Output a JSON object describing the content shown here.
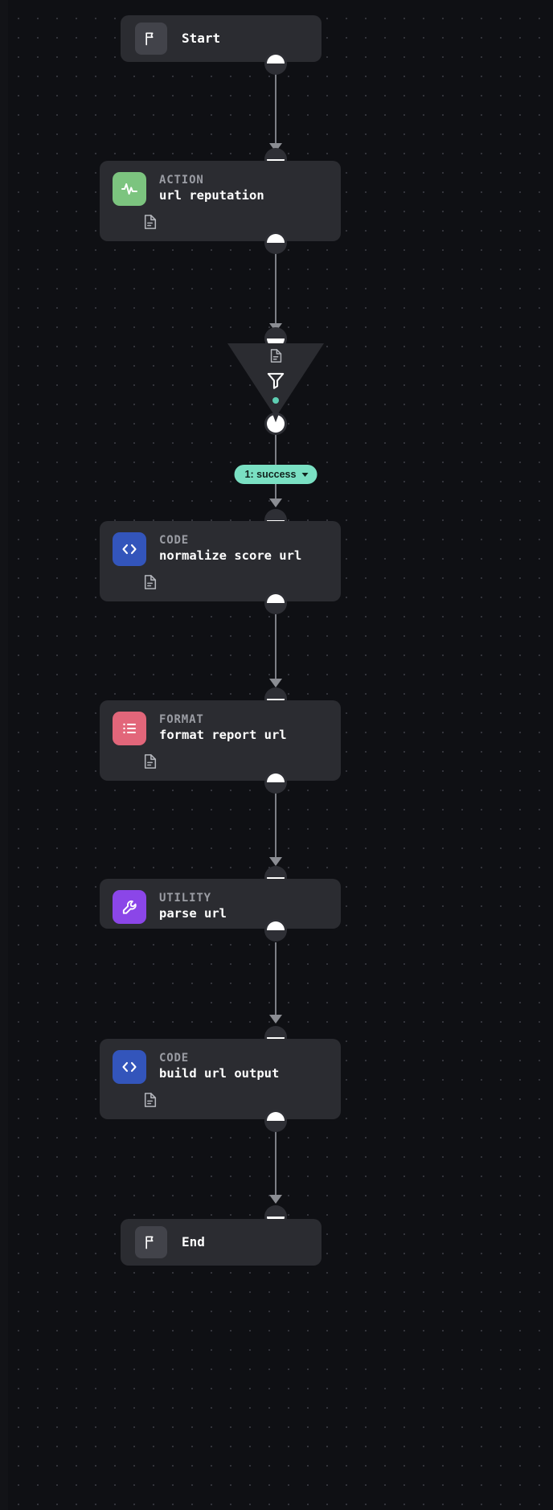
{
  "canvas": {
    "background_color": "#0f1014",
    "dot_grid_color": "#33343b"
  },
  "workflow": {
    "start": {
      "label": "Start",
      "icon": "flag-icon"
    },
    "end": {
      "label": "End",
      "icon": "flag-icon"
    },
    "nodes": [
      {
        "kind": "ACTION",
        "title": "url reputation",
        "icon": "activity-pulse-icon",
        "icon_color": "#7cc47f",
        "note_icon": "document-icon"
      },
      {
        "kind": "CODE",
        "title": "normalize score url",
        "icon": "code-brackets-icon",
        "icon_color": "#3355bb",
        "note_icon": "document-icon"
      },
      {
        "kind": "FORMAT",
        "title": "format report url",
        "icon": "bullet-list-icon",
        "icon_color": "#e2667a",
        "note_icon": "document-icon"
      },
      {
        "kind": "UTILITY",
        "title": "parse url",
        "icon": "wrench-icon",
        "icon_color": "#8b46e8",
        "note_icon": null
      },
      {
        "kind": "CODE",
        "title": "build url output",
        "icon": "code-brackets-icon",
        "icon_color": "#3355bb",
        "note_icon": "document-icon"
      }
    ],
    "filter": {
      "icon": "funnel-icon",
      "note_icon": "document-icon",
      "status_dot_color": "#5ecfb3"
    },
    "branch": {
      "label": "1: success",
      "badge_color": "#7ae0c3",
      "caret_icon": "chevron-down-icon"
    }
  }
}
